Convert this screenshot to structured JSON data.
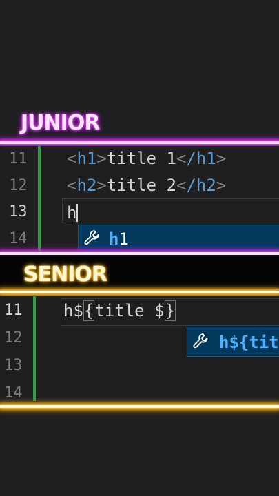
{
  "junior": {
    "title": "JUNIOR",
    "line_numbers": [
      "11",
      "12",
      "13",
      "14"
    ],
    "line1": {
      "open_tag": "h1",
      "text": "title 1",
      "close_tag": "/h1"
    },
    "line2": {
      "open_tag": "h2",
      "text": "title 2",
      "close_tag": "/h2"
    },
    "typed": "h",
    "suggestion": {
      "match": "h",
      "rest": "1",
      "icon": "wrench-icon"
    }
  },
  "senior": {
    "title": "SENIOR",
    "line_numbers": [
      "11",
      "12",
      "13",
      "14"
    ],
    "code": {
      "prefix": "h$",
      "open_brace": "{",
      "middle": "title $",
      "close_brace": "}"
    },
    "suggestion": {
      "match": "h${",
      "rest": "tit",
      "icon": "wrench-icon"
    }
  },
  "colors": {
    "junior_accent": "#e33cff",
    "senior_accent": "#ffbf2e",
    "suggestion_bg": "#04395e",
    "gutter_modified": "#2ea043"
  }
}
